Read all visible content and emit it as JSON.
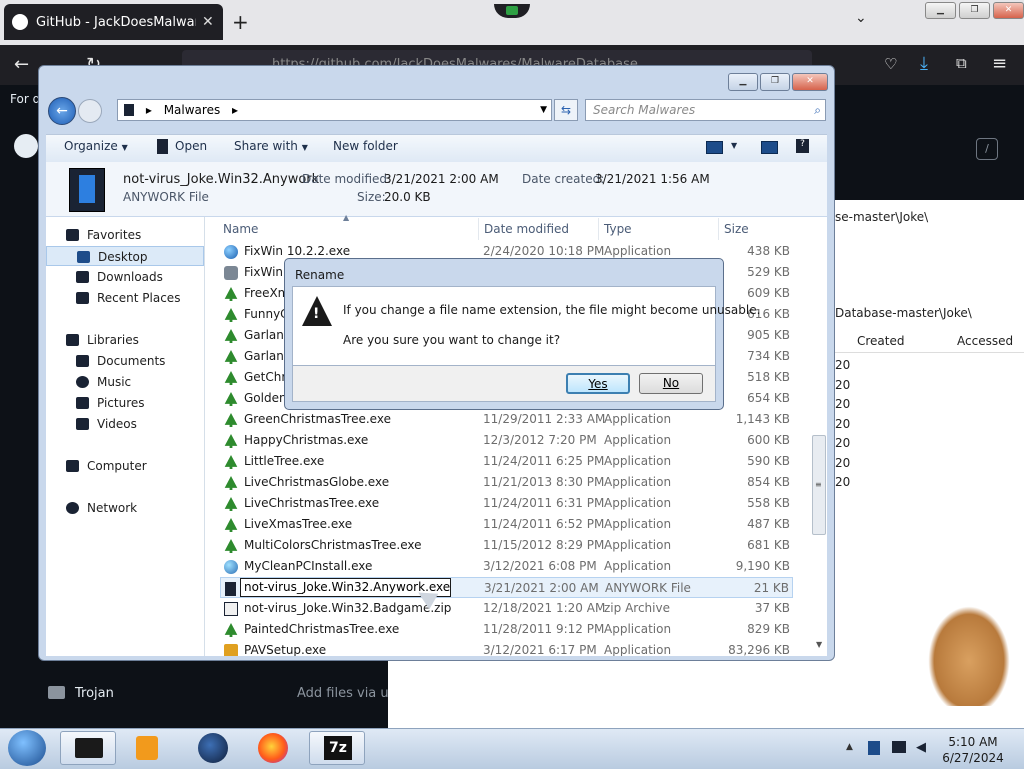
{
  "browser": {
    "tab_title": "GitHub - JackDoesMalwares/M...",
    "tab_close": "✕",
    "new_tab": "+",
    "url": "https://github.com/JackDoesMalwares/MalwareDatabase",
    "left_text": "For q",
    "trojan_folder": "Trojan",
    "add_files": "Add files via u",
    "right_path": "Database-master\\Joke\\",
    "right_path_top": "se-master\\Joke\\",
    "right_col_created": "Created",
    "right_col_accessed": "Accessed",
    "right_row_stub": "20"
  },
  "explorer": {
    "breadcrumb": "Malwares",
    "search_placeholder": "Search Malwares",
    "toolbar": {
      "organize": "Organize",
      "open": "Open",
      "share_with": "Share with",
      "new_folder": "New folder"
    },
    "details": {
      "name": "not-virus_Joke.Win32.Anywork",
      "type": "ANYWORK File",
      "date_modified_label": "Date modified:",
      "date_modified": "3/21/2021 2:00 AM",
      "size_label": "Size:",
      "size": "20.0 KB",
      "date_created_label": "Date created:",
      "date_created": "3/21/2021 1:56 AM"
    },
    "nav": {
      "favorites": "Favorites",
      "desktop": "Desktop",
      "downloads": "Downloads",
      "recent_places": "Recent Places",
      "libraries": "Libraries",
      "documents": "Documents",
      "music": "Music",
      "pictures": "Pictures",
      "videos": "Videos",
      "computer": "Computer",
      "network": "Network"
    },
    "columns": {
      "name": "Name",
      "date_modified": "Date modified",
      "type": "Type",
      "size": "Size"
    },
    "files": [
      {
        "name": "FixWin 10.2.2.exe",
        "date": "2/24/2020 10:18 PM",
        "type": "Application",
        "size": "438 KB"
      },
      {
        "name": "FixWin",
        "date": "",
        "type": "",
        "size": "529 KB"
      },
      {
        "name": "FreeXm",
        "date": "",
        "type": "",
        "size": "609 KB"
      },
      {
        "name": "FunnyC",
        "date": "",
        "type": "",
        "size": "616 KB"
      },
      {
        "name": "Garlanc",
        "date": "",
        "type": "",
        "size": "905 KB"
      },
      {
        "name": "Garlanc",
        "date": "",
        "type": "",
        "size": "734 KB"
      },
      {
        "name": "GetChri",
        "date": "",
        "type": "",
        "size": "518 KB"
      },
      {
        "name": "Golden",
        "date": "",
        "type": "",
        "size": "654 KB"
      },
      {
        "name": "GreenChristmasTree.exe",
        "date": "11/29/2011 2:33 AM",
        "type": "Application",
        "size": "1,143 KB"
      },
      {
        "name": "HappyChristmas.exe",
        "date": "12/3/2012 7:20 PM",
        "type": "Application",
        "size": "600 KB"
      },
      {
        "name": "LittleTree.exe",
        "date": "11/24/2011 6:25 PM",
        "type": "Application",
        "size": "590 KB"
      },
      {
        "name": "LiveChristmasGlobe.exe",
        "date": "11/21/2013 8:30 PM",
        "type": "Application",
        "size": "854 KB"
      },
      {
        "name": "LiveChristmasTree.exe",
        "date": "11/24/2011 6:31 PM",
        "type": "Application",
        "size": "558 KB"
      },
      {
        "name": "LiveXmasTree.exe",
        "date": "11/24/2011 6:52 PM",
        "type": "Application",
        "size": "487 KB"
      },
      {
        "name": "MultiColorsChristmasTree.exe",
        "date": "11/15/2012 8:29 PM",
        "type": "Application",
        "size": "681 KB"
      },
      {
        "name": "MyCleanPCInstall.exe",
        "date": "3/12/2021 6:08 PM",
        "type": "Application",
        "size": "9,190 KB"
      },
      {
        "name": "not-virus_Joke.Win32.Anywork.exe",
        "date": "3/21/2021 2:00 AM",
        "type": "ANYWORK File",
        "size": "21 KB"
      },
      {
        "name": "not-virus_Joke.Win32.Badgame.zip",
        "date": "12/18/2021 1:20 AM",
        "type": "zip Archive",
        "size": "37 KB"
      },
      {
        "name": "PaintedChristmasTree.exe",
        "date": "11/28/2011 9:12 PM",
        "type": "Application",
        "size": "829 KB"
      },
      {
        "name": "PAVSetup.exe",
        "date": "3/12/2021 6:17 PM",
        "type": "Application",
        "size": "83,296 KB"
      }
    ]
  },
  "dialog": {
    "title": "Rename",
    "line1": "If you change a file name extension, the file might become unusable.",
    "line2": "Are you sure you want to change it?",
    "yes": "Yes",
    "no": "No"
  },
  "taskbar": {
    "time": "5:10 AM",
    "date": "6/27/2024",
    "sevenzip": "7z"
  }
}
